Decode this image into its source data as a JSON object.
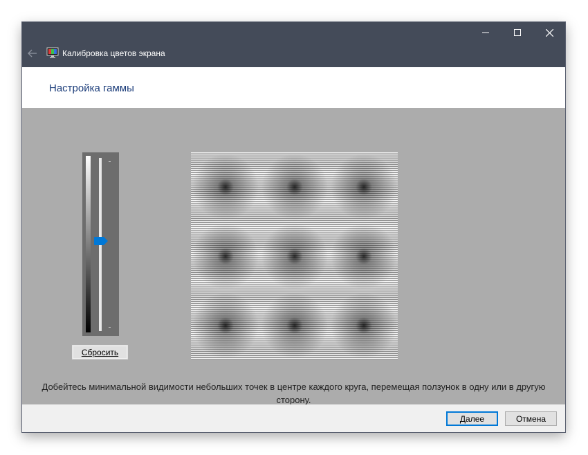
{
  "window": {
    "title": "Калибровка цветов экрана",
    "icons": {
      "back": "back-arrow-icon",
      "app": "color-calibration-icon",
      "minimize": "minimize-icon",
      "maximize": "maximize-icon",
      "close": "close-icon"
    }
  },
  "header": {
    "title": "Настройка гаммы"
  },
  "gamma": {
    "reset_label": "Сбросить",
    "slider_level_percent": 52
  },
  "instruction": "Добейтесь минимальной видимости небольших точек в центре каждого круга, перемещая ползунок в одну или в другую сторону.",
  "footer": {
    "next_label": "Далее",
    "cancel_label": "Отмена"
  },
  "colors": {
    "titlebar": "#444b59",
    "content_bg": "#acacac",
    "accent": "#0078d7",
    "heading": "#1c3d7a"
  }
}
